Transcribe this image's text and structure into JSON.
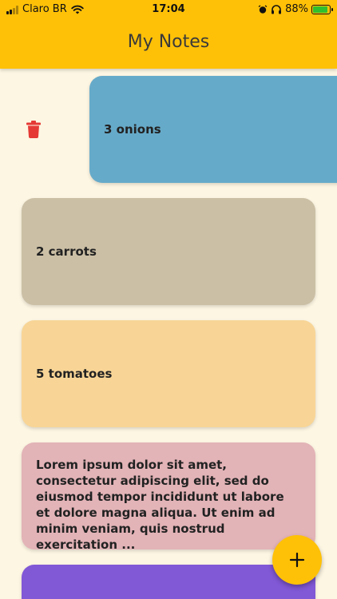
{
  "status_bar": {
    "carrier": "Claro BR",
    "time": "17:04",
    "battery": "88%",
    "icons": [
      "signal-icon",
      "wifi-icon",
      "alarm-icon",
      "headphones-icon",
      "battery-charging-icon"
    ]
  },
  "app_bar": {
    "title": "My Notes",
    "color": "#ffc107"
  },
  "notes": [
    {
      "text": "3 onions",
      "color": "#66aac9",
      "swiped": true
    },
    {
      "text": "2 carrots",
      "color": "#cbbfa5"
    },
    {
      "text": "5 tomatoes",
      "color": "#f8d596"
    },
    {
      "text": "Lorem ipsum dolor sit amet, consectetur adipiscing elit, sed do eiusmod tempor incididunt ut labore et dolore magna aliqua. Ut enim ad minim veniam, quis nostrud exercitation ...",
      "color": "#e2b3b7"
    },
    {
      "text": "",
      "color": "#8158d6"
    }
  ],
  "actions": {
    "delete_icon": "trash-icon",
    "delete_color": "#e53935",
    "fab_icon": "plus-icon"
  }
}
